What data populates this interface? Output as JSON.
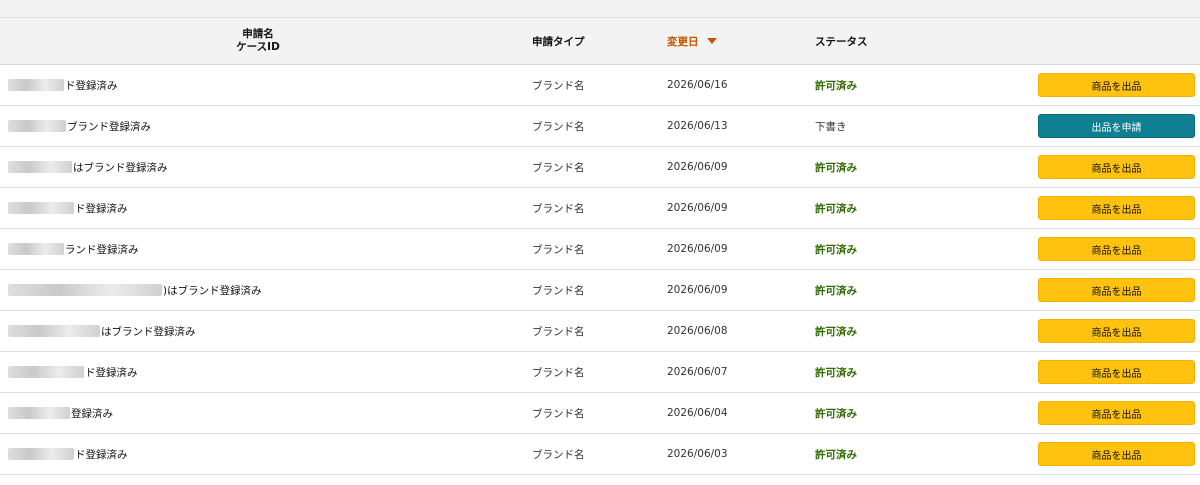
{
  "table": {
    "columns": {
      "name_line1": "申請名",
      "name_line2": "ケースID",
      "type": "申請タイプ",
      "date": "変更日",
      "status": "ステータス"
    },
    "rows": [
      {
        "name": "ド登録済み",
        "type": "ブランド名",
        "date": "2026/06/16",
        "status": "許可済み",
        "status_kind": "approved",
        "action": "商品を出品",
        "action_kind": "yellow"
      },
      {
        "name": "ブランド登録済み",
        "type": "ブランド名",
        "date": "2026/06/13",
        "status": "下書き",
        "status_kind": "draft",
        "action": "出品を申請",
        "action_kind": "teal"
      },
      {
        "name": "はブランド登録済み",
        "type": "ブランド名",
        "date": "2026/06/09",
        "status": "許可済み",
        "status_kind": "approved",
        "action": "商品を出品",
        "action_kind": "yellow"
      },
      {
        "name": "ド登録済み",
        "type": "ブランド名",
        "date": "2026/06/09",
        "status": "許可済み",
        "status_kind": "approved",
        "action": "商品を出品",
        "action_kind": "yellow"
      },
      {
        "name": "ランド登録済み",
        "type": "ブランド名",
        "date": "2026/06/09",
        "status": "許可済み",
        "status_kind": "approved",
        "action": "商品を出品",
        "action_kind": "yellow"
      },
      {
        "name": ")はブランド登録済み",
        "type": "ブランド名",
        "date": "2026/06/09",
        "status": "許可済み",
        "status_kind": "approved",
        "action": "商品を出品",
        "action_kind": "yellow"
      },
      {
        "name": "はブランド登録済み",
        "type": "ブランド名",
        "date": "2026/06/08",
        "status": "許可済み",
        "status_kind": "approved",
        "action": "商品を出品",
        "action_kind": "yellow"
      },
      {
        "name": "ド登録済み",
        "type": "ブランド名",
        "date": "2026/06/07",
        "status": "許可済み",
        "status_kind": "approved",
        "action": "商品を出品",
        "action_kind": "yellow"
      },
      {
        "name": "登録済み",
        "type": "ブランド名",
        "date": "2026/06/04",
        "status": "許可済み",
        "status_kind": "approved",
        "action": "商品を出品",
        "action_kind": "yellow"
      },
      {
        "name": "ド登録済み",
        "type": "ブランド名",
        "date": "2026/06/03",
        "status": "許可済み",
        "status_kind": "approved",
        "action": "商品を出品",
        "action_kind": "yellow"
      }
    ]
  }
}
